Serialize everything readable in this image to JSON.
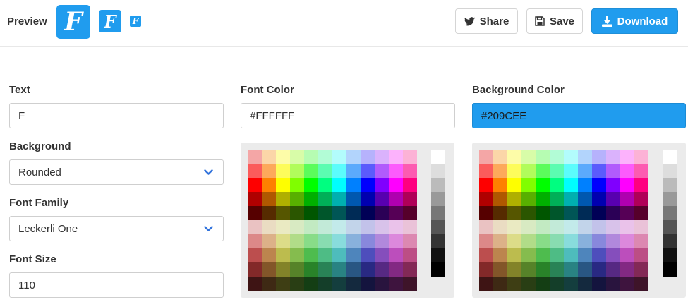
{
  "header": {
    "preview_label": "Preview",
    "favicon_letter": "F",
    "accent_color": "#209CEE",
    "buttons": {
      "share": "Share",
      "save": "Save",
      "download": "Download"
    }
  },
  "form": {
    "text": {
      "label": "Text",
      "value": "F"
    },
    "background": {
      "label": "Background",
      "value": "Rounded"
    },
    "font_family": {
      "label": "Font Family",
      "value": "Leckerli One"
    },
    "font_size": {
      "label": "Font Size",
      "value": "110"
    },
    "font_color": {
      "label": "Font Color",
      "value": "#FFFFFF"
    },
    "background_color": {
      "label": "Background Color",
      "value": "#209CEE"
    }
  },
  "palette": {
    "grid": [
      [
        "#f4a6a6",
        "#fbd6a8",
        "#fdfca8",
        "#d8fca8",
        "#b6fcb2",
        "#b2fcd6",
        "#b2fcfc",
        "#b2d4fc",
        "#b6b2fc",
        "#dab2fc",
        "#fcb2fc",
        "#fcb2d6"
      ],
      [
        "#fb5b5b",
        "#fda95b",
        "#fdfc5b",
        "#b1fc5b",
        "#5bfc5b",
        "#5bfcb1",
        "#5bfcfc",
        "#5baafc",
        "#5b5bfc",
        "#b15bfc",
        "#fc5bfc",
        "#fc5bb1"
      ],
      [
        "#fe0000",
        "#fe8000",
        "#fefe00",
        "#80fe00",
        "#00fe00",
        "#00fe80",
        "#00fefe",
        "#0080fe",
        "#0000fe",
        "#8000fe",
        "#fe00fe",
        "#fe0080"
      ],
      [
        "#b00000",
        "#b05800",
        "#b0b000",
        "#58b000",
        "#00b000",
        "#00b058",
        "#00b0b0",
        "#0058b0",
        "#0000b0",
        "#5800b0",
        "#b000b0",
        "#b00058"
      ],
      [
        "#560000",
        "#562b00",
        "#565600",
        "#2b5600",
        "#005600",
        "#00562b",
        "#005656",
        "#002b56",
        "#000056",
        "#2b0056",
        "#560056",
        "#56002b"
      ],
      [
        "#eac2c2",
        "#eadcc2",
        "#eaeac2",
        "#d8eac2",
        "#c2eac2",
        "#c2ead8",
        "#c2eaea",
        "#c2d4ea",
        "#c2c2ea",
        "#d8c2ea",
        "#eac2ea",
        "#eac2d8"
      ],
      [
        "#dc8888",
        "#dcb188",
        "#dcdc88",
        "#b1dc88",
        "#88dc88",
        "#88dcb1",
        "#88dcdc",
        "#88b1dc",
        "#8888dc",
        "#b188dc",
        "#dc88dc",
        "#dc88b1"
      ],
      [
        "#bc4e4e",
        "#bc854e",
        "#bcbc4e",
        "#85bc4e",
        "#4ebc4e",
        "#4ebc85",
        "#4ebcbc",
        "#4e85bc",
        "#4e4ebc",
        "#854ebc",
        "#bc4ebc",
        "#bc4e85"
      ],
      [
        "#832929",
        "#835629",
        "#838329",
        "#568329",
        "#298329",
        "#298356",
        "#298383",
        "#295683",
        "#292983",
        "#562983",
        "#832983",
        "#832956"
      ],
      [
        "#3e1414",
        "#3e2914",
        "#3e3e14",
        "#293e14",
        "#143e14",
        "#143e29",
        "#143e3e",
        "#14293e",
        "#14143e",
        "#29143e",
        "#3e143e",
        "#3e1429"
      ]
    ],
    "grays": [
      "#ffffff",
      "#dddddd",
      "#bbbbbb",
      "#999999",
      "#777777",
      "#555555",
      "#333333",
      "#111111",
      "#000000"
    ]
  }
}
